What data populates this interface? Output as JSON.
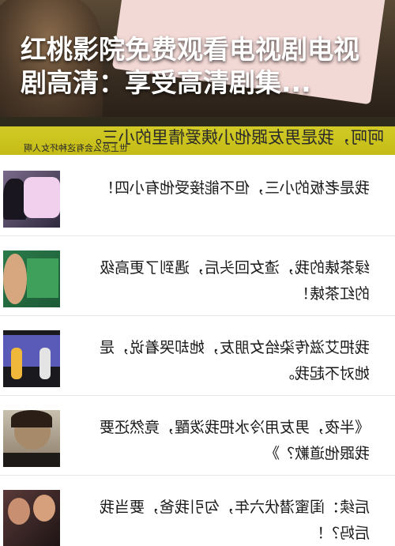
{
  "hero": {
    "title": "红桃影院免费观看电视剧电视剧高清：享受高清剧集..."
  },
  "headline": {
    "text": "呵呵，我是男友跟他小姨爱情里的小三。",
    "subtext": "世上总么会有这种坏女人啊"
  },
  "articles": [
    {
      "text": "我是老板的小三，但不能接受他有小四！"
    },
    {
      "text": "绿茶婊的我，渣女回头后，遇到了更高级的红茶婊！"
    },
    {
      "text": "我把艾滋传染给女朋友，她却哭着说，是她对不起我。"
    },
    {
      "text": "《半夜，男友用冷水把我泼醒，竟然还要我跟他道歉？》"
    },
    {
      "text": "后续：闺蜜潜伏六年，勾引我爸，要当我后妈？！"
    }
  ],
  "colors": {
    "headline_bar": "#cfc61f",
    "hero_text": "#ffffff"
  }
}
